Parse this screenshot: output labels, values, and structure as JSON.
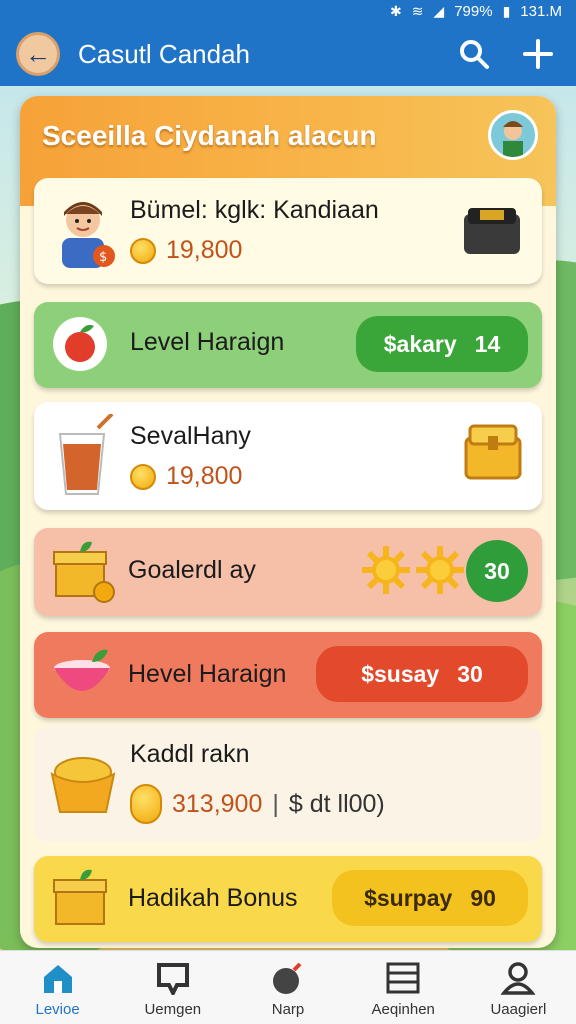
{
  "status": {
    "battery": "799%",
    "time": "131.M"
  },
  "appbar": {
    "title": "Casutl Candah",
    "icons": [
      "back-arrow-icon",
      "search-icon",
      "plus-icon"
    ]
  },
  "panel": {
    "title": "Sceeilla Ciydanah alacun"
  },
  "cards": [
    {
      "title": "Bümel: kglk: Kandiaan",
      "amount": "19,800",
      "icon": "character-icon",
      "thumb": "chest-icon"
    },
    {
      "title": "Level Haraign",
      "pill_label": "$akary",
      "pill_value": "14",
      "icon": "apple-icon",
      "pill_color": "#3aa63a"
    },
    {
      "title": "SevalHany",
      "amount": "19,800",
      "icon": "juice-glass-icon",
      "thumb": "yellow-chest-icon"
    },
    {
      "title": "Goalerdl ay",
      "badge": "30",
      "icon": "gift-box-icon",
      "badge_color": "#2f9e3a"
    },
    {
      "title": "Hevel Haraign",
      "pill_label": "$susay",
      "pill_value": "30",
      "icon": "bowl-icon",
      "pill_color": "#e34a2c"
    },
    {
      "title": "Kaddl rakn",
      "amount": "313,900",
      "extra": "$ dt ll00)",
      "icon": "pie-icon"
    },
    {
      "title": "Hadikah Bonus",
      "pill_label": "$surpay",
      "pill_value": "90",
      "icon": "gift-box-icon",
      "pill_color": "#f4c21f"
    }
  ],
  "nav": [
    {
      "label": "Levioe",
      "icon": "home-icon"
    },
    {
      "label": "Uemgen",
      "icon": "chat-icon"
    },
    {
      "label": "Narp",
      "icon": "bomb-icon"
    },
    {
      "label": "Aeqinhen",
      "icon": "list-icon"
    },
    {
      "label": "Uaagierl",
      "icon": "profile-icon"
    }
  ]
}
